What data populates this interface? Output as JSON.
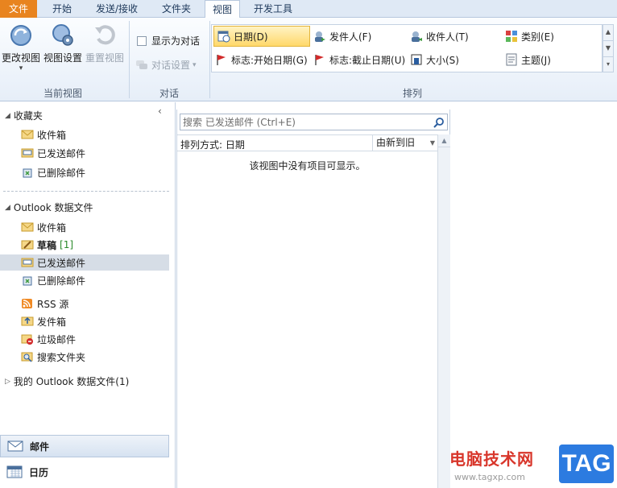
{
  "tabs": [
    {
      "label": "文件"
    },
    {
      "label": "开始"
    },
    {
      "label": "发送/接收"
    },
    {
      "label": "文件夹"
    },
    {
      "label": "视图"
    },
    {
      "label": "开发工具"
    }
  ],
  "ribbon": {
    "current_view": {
      "group_label": "当前视图",
      "change_view": "更改视图",
      "view_settings": "视图设置",
      "reset_view": "重置视图"
    },
    "conversations": {
      "group_label": "对话",
      "show_as_conversations": "显示为对话",
      "show_as_conversations_checked": false,
      "conversation_settings": "对话设置"
    },
    "arrangement": {
      "group_label": "排列",
      "options": [
        {
          "label": "日期(D)",
          "icon": "date-icon",
          "selected": true
        },
        {
          "label": "发件人(F)",
          "icon": "sender-icon"
        },
        {
          "label": "收件人(T)",
          "icon": "recipient-icon"
        },
        {
          "label": "类别(E)",
          "icon": "category-icon"
        },
        {
          "label": "标志:开始日期(G)",
          "icon": "flag-icon"
        },
        {
          "label": "标志:截止日期(U)",
          "icon": "flag-icon"
        },
        {
          "label": "大小(S)",
          "icon": "size-icon"
        },
        {
          "label": "主题(J)",
          "icon": "subject-icon"
        }
      ]
    }
  },
  "nav": {
    "favorites_header": "收藏夹",
    "favorites": [
      {
        "label": "收件箱",
        "icon": "inbox-icon"
      },
      {
        "label": "已发送邮件",
        "icon": "sent-icon"
      },
      {
        "label": "已删除邮件",
        "icon": "deleted-icon"
      }
    ],
    "data_file_header": "Outlook 数据文件",
    "data_file_items": [
      {
        "label": "收件箱",
        "icon": "inbox-icon"
      },
      {
        "label": "草稿",
        "count": "[1]",
        "icon": "drafts-icon"
      },
      {
        "label": "已发送邮件",
        "icon": "sent-icon",
        "selected": true
      },
      {
        "label": "已删除邮件",
        "icon": "deleted-icon"
      },
      {
        "label": "RSS 源",
        "icon": "rss-icon"
      },
      {
        "label": "发件箱",
        "icon": "outbox-icon"
      },
      {
        "label": "垃圾邮件",
        "icon": "junk-icon"
      },
      {
        "label": "搜索文件夹",
        "icon": "search-folder-icon"
      }
    ],
    "my_data_files": "我的 Outlook 数据文件(1)",
    "mail": "邮件",
    "calendar": "日历"
  },
  "list": {
    "search_placeholder": "搜索 已发送邮件 (Ctrl+E)",
    "sort_label": "排列方式: 日期",
    "sort_order": "由新到旧",
    "empty_message": "该视图中没有项目可显示。"
  },
  "watermark": {
    "site_name": "电脑技术网",
    "url": "www.tagxp.com",
    "tag": "TAG"
  },
  "colors": {
    "file_tab": "#e8841f",
    "selected_arrange": "#ffd86a",
    "watermark_red": "#d8362b",
    "watermark_blue": "#2c7be0"
  }
}
